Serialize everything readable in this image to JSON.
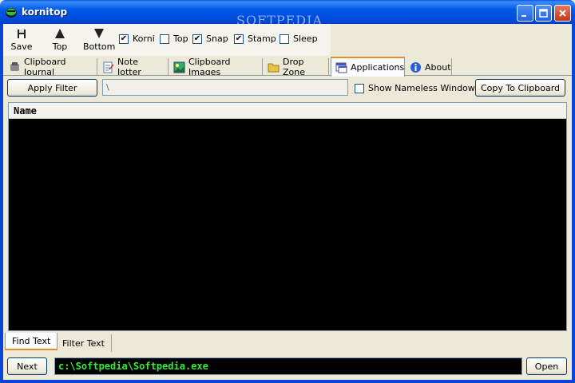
{
  "window": {
    "title": "kornitop",
    "watermark": "SOFTPEDIA",
    "controls": [
      "minimize-icon",
      "maximize-icon",
      "close-icon"
    ]
  },
  "toolbar": {
    "buttons": [
      {
        "label": "Save",
        "icon": "save-icon"
      },
      {
        "label": "Top",
        "icon": "arrow-up-icon"
      },
      {
        "label": "Bottom",
        "icon": "arrow-down-icon"
      }
    ],
    "checkboxes": [
      {
        "label": "Korni",
        "checked": true
      },
      {
        "label": "Top",
        "checked": false
      },
      {
        "label": "Snap",
        "checked": true
      },
      {
        "label": "Stamp",
        "checked": true
      },
      {
        "label": "Sleep",
        "checked": false
      }
    ]
  },
  "tabs": [
    {
      "label": "Clipboard Journal",
      "icon": "clipboard-journal-icon",
      "active": false
    },
    {
      "label": "Note Jotter",
      "icon": "note-icon",
      "active": false
    },
    {
      "label": "Clipboard Images",
      "icon": "image-icon",
      "active": false
    },
    {
      "label": "Drop Zone",
      "icon": "folder-icon",
      "active": false
    },
    {
      "label": "Applications",
      "icon": "applications-icon",
      "active": true
    },
    {
      "label": "About",
      "icon": "info-icon",
      "active": false
    }
  ],
  "applications": {
    "apply_filter_label": "Apply Filter",
    "filter_value": "\\",
    "show_nameless_label": "Show Nameless Windows",
    "show_nameless_checked": false,
    "copy_label": "Copy To Clipboard",
    "list_header": "Name",
    "rows": []
  },
  "bottom_tabs": [
    {
      "label": "Find Text",
      "active": true
    },
    {
      "label": "Filter Text",
      "active": false
    }
  ],
  "bottom": {
    "next_label": "Next",
    "path_value": "c:\\Softpedia\\Softpedia.exe",
    "open_label": "Open"
  },
  "colors": {
    "titlebar": "#0058e8",
    "active_tab_accent": "#e68b2c",
    "list_background": "#000000",
    "path_text": "#33ee33"
  }
}
